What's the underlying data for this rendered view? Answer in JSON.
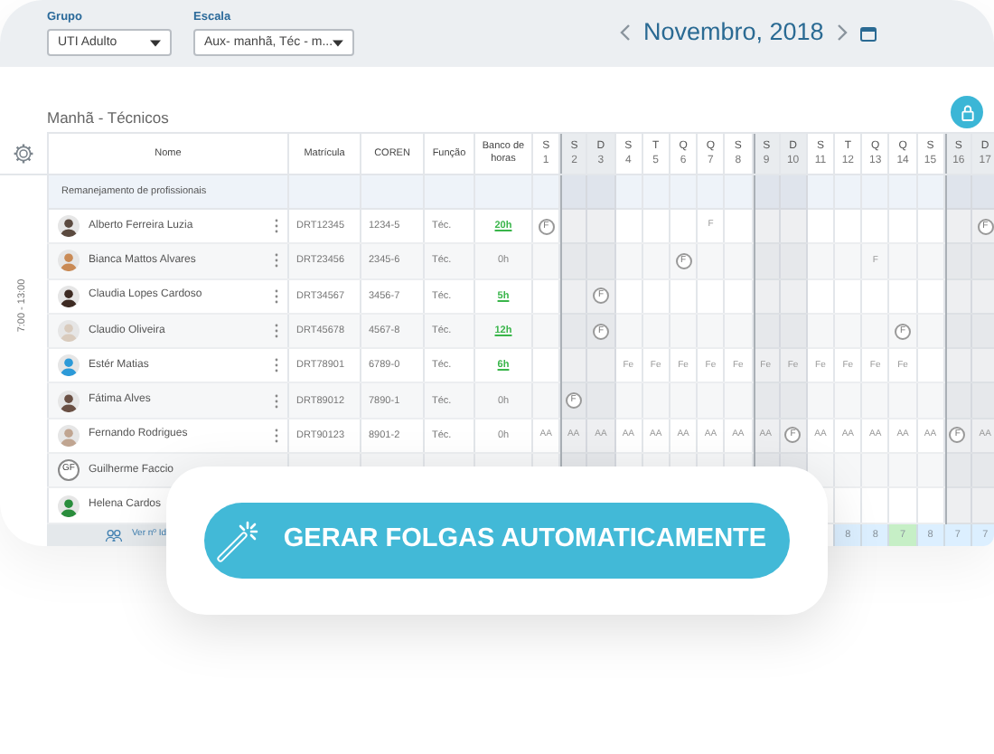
{
  "filters": [
    {
      "label": "Grupo",
      "value": "UTI Adulto"
    },
    {
      "label": "Escala",
      "value": "Aux- manhã, Téc - m..."
    }
  ],
  "month": "Novembro, 2018",
  "section_title": "Manhã - Técnicos",
  "shift": "7:00 - 13:00",
  "columns": [
    "Nome",
    "Matrícula",
    "COREN",
    "Função",
    "Banco de horas"
  ],
  "days": [
    {
      "weekday": "S",
      "number": "1",
      "weekend": false
    },
    {
      "weekday": "S",
      "number": "2",
      "weekend": true
    },
    {
      "weekday": "D",
      "number": "3",
      "weekend": true
    },
    {
      "weekday": "S",
      "number": "4",
      "weekend": false
    },
    {
      "weekday": "T",
      "number": "5",
      "weekend": false
    },
    {
      "weekday": "Q",
      "number": "6",
      "weekend": false
    },
    {
      "weekday": "Q",
      "number": "7",
      "weekend": false
    },
    {
      "weekday": "S",
      "number": "8",
      "weekend": false
    },
    {
      "weekday": "S",
      "number": "9",
      "weekend": true
    },
    {
      "weekday": "D",
      "number": "10",
      "weekend": true
    },
    {
      "weekday": "S",
      "number": "11",
      "weekend": false
    },
    {
      "weekday": "T",
      "number": "12",
      "weekend": false
    },
    {
      "weekday": "Q",
      "number": "13",
      "weekend": false
    },
    {
      "weekday": "Q",
      "number": "14",
      "weekend": false
    },
    {
      "weekday": "S",
      "number": "15",
      "weekend": false
    },
    {
      "weekday": "S",
      "number": "16",
      "weekend": true
    },
    {
      "weekday": "D",
      "number": "17",
      "weekend": true
    }
  ],
  "group_row": "Remanejamento de profissionais",
  "rows": [
    {
      "avatar": {
        "kind": "photo"
      },
      "name": "Alberto Ferreira Luzia",
      "more_button": true,
      "matricula": "DRT12345",
      "coren": "1234-5",
      "funcao": "Téc.",
      "banco": {
        "text": "20h",
        "highlighted": true
      },
      "days": [
        {
          "kind": "badge",
          "text": "F"
        },
        {
          "kind": "empty"
        },
        {
          "kind": "empty"
        },
        {
          "kind": "empty"
        },
        {
          "kind": "empty"
        },
        {
          "kind": "empty"
        },
        {
          "kind": "mark",
          "text": "F"
        },
        {
          "kind": "empty"
        },
        {
          "kind": "empty"
        },
        {
          "kind": "empty"
        },
        {
          "kind": "empty"
        },
        {
          "kind": "empty"
        },
        {
          "kind": "empty"
        },
        {
          "kind": "empty"
        },
        {
          "kind": "empty"
        },
        {
          "kind": "empty"
        },
        {
          "kind": "badge",
          "text": "F"
        }
      ]
    },
    {
      "avatar": {
        "kind": "photo"
      },
      "name": "Bianca Mattos Alvares",
      "more_button": true,
      "matricula": "DRT23456",
      "coren": "2345-6",
      "funcao": "Téc.",
      "banco": {
        "text": "0h",
        "highlighted": false
      },
      "days": [
        {
          "kind": "empty"
        },
        {
          "kind": "empty"
        },
        {
          "kind": "empty"
        },
        {
          "kind": "empty"
        },
        {
          "kind": "empty"
        },
        {
          "kind": "badge",
          "text": "F"
        },
        {
          "kind": "empty"
        },
        {
          "kind": "empty"
        },
        {
          "kind": "empty"
        },
        {
          "kind": "empty"
        },
        {
          "kind": "empty"
        },
        {
          "kind": "empty"
        },
        {
          "kind": "mark",
          "text": "F"
        },
        {
          "kind": "empty"
        },
        {
          "kind": "empty"
        },
        {
          "kind": "empty"
        },
        {
          "kind": "empty"
        }
      ]
    },
    {
      "avatar": {
        "kind": "photo"
      },
      "name": "Claudia Lopes Cardoso",
      "more_button": true,
      "matricula": "DRT34567",
      "coren": "3456-7",
      "funcao": "Téc.",
      "banco": {
        "text": "5h",
        "highlighted": true
      },
      "days": [
        {
          "kind": "empty"
        },
        {
          "kind": "empty"
        },
        {
          "kind": "badge",
          "text": "F"
        },
        {
          "kind": "empty"
        },
        {
          "kind": "empty"
        },
        {
          "kind": "empty"
        },
        {
          "kind": "empty"
        },
        {
          "kind": "empty"
        },
        {
          "kind": "empty"
        },
        {
          "kind": "empty"
        },
        {
          "kind": "empty"
        },
        {
          "kind": "empty"
        },
        {
          "kind": "empty"
        },
        {
          "kind": "empty"
        },
        {
          "kind": "empty"
        },
        {
          "kind": "empty"
        },
        {
          "kind": "empty"
        }
      ]
    },
    {
      "avatar": {
        "kind": "photo"
      },
      "name": "Claudio Oliveira",
      "more_button": true,
      "matricula": "DRT45678",
      "coren": "4567-8",
      "funcao": "Téc.",
      "banco": {
        "text": "12h",
        "highlighted": true
      },
      "days": [
        {
          "kind": "empty"
        },
        {
          "kind": "empty"
        },
        {
          "kind": "badge",
          "text": "F"
        },
        {
          "kind": "empty"
        },
        {
          "kind": "empty"
        },
        {
          "kind": "empty"
        },
        {
          "kind": "empty"
        },
        {
          "kind": "empty"
        },
        {
          "kind": "empty"
        },
        {
          "kind": "empty"
        },
        {
          "kind": "empty"
        },
        {
          "kind": "empty"
        },
        {
          "kind": "empty"
        },
        {
          "kind": "badge",
          "text": "F"
        },
        {
          "kind": "empty"
        },
        {
          "kind": "empty"
        },
        {
          "kind": "empty"
        }
      ]
    },
    {
      "avatar": {
        "kind": "photo"
      },
      "name": "Estér Matias",
      "more_button": true,
      "matricula": "DRT78901",
      "coren": "6789-0",
      "funcao": "Téc.",
      "banco": {
        "text": "6h",
        "highlighted": true
      },
      "days": [
        {
          "kind": "empty"
        },
        {
          "kind": "empty"
        },
        {
          "kind": "empty"
        },
        {
          "kind": "mark",
          "text": "Fe"
        },
        {
          "kind": "mark",
          "text": "Fe"
        },
        {
          "kind": "mark",
          "text": "Fe"
        },
        {
          "kind": "mark",
          "text": "Fe"
        },
        {
          "kind": "mark",
          "text": "Fe"
        },
        {
          "kind": "mark",
          "text": "Fe"
        },
        {
          "kind": "mark",
          "text": "Fe"
        },
        {
          "kind": "mark",
          "text": "Fe"
        },
        {
          "kind": "mark",
          "text": "Fe"
        },
        {
          "kind": "mark",
          "text": "Fe"
        },
        {
          "kind": "mark",
          "text": "Fe"
        },
        {
          "kind": "empty"
        },
        {
          "kind": "empty"
        },
        {
          "kind": "empty"
        }
      ]
    },
    {
      "avatar": {
        "kind": "photo"
      },
      "name": "Fátima Alves",
      "more_button": true,
      "matricula": "DRT89012",
      "coren": "7890-1",
      "funcao": "Téc.",
      "banco": {
        "text": "0h",
        "highlighted": false
      },
      "days": [
        {
          "kind": "empty"
        },
        {
          "kind": "badge",
          "text": "F"
        },
        {
          "kind": "empty"
        },
        {
          "kind": "empty"
        },
        {
          "kind": "empty"
        },
        {
          "kind": "empty"
        },
        {
          "kind": "empty"
        },
        {
          "kind": "empty"
        },
        {
          "kind": "empty"
        },
        {
          "kind": "empty"
        },
        {
          "kind": "empty"
        },
        {
          "kind": "empty"
        },
        {
          "kind": "empty"
        },
        {
          "kind": "empty"
        },
        {
          "kind": "empty"
        },
        {
          "kind": "empty"
        },
        {
          "kind": "empty"
        }
      ]
    },
    {
      "avatar": {
        "kind": "photo"
      },
      "name": "Fernando Rodrigues",
      "more_button": true,
      "matricula": "DRT90123",
      "coren": "8901-2",
      "funcao": "Téc.",
      "banco": {
        "text": "0h",
        "highlighted": false
      },
      "days": [
        {
          "kind": "mark",
          "text": "AA"
        },
        {
          "kind": "mark",
          "text": "AA"
        },
        {
          "kind": "mark",
          "text": "AA"
        },
        {
          "kind": "mark",
          "text": "AA"
        },
        {
          "kind": "mark",
          "text": "AA"
        },
        {
          "kind": "mark",
          "text": "AA"
        },
        {
          "kind": "mark",
          "text": "AA"
        },
        {
          "kind": "mark",
          "text": "AA"
        },
        {
          "kind": "mark",
          "text": "AA"
        },
        {
          "kind": "badge",
          "text": "F"
        },
        {
          "kind": "mark",
          "text": "AA"
        },
        {
          "kind": "mark",
          "text": "AA"
        },
        {
          "kind": "mark",
          "text": "AA"
        },
        {
          "kind": "mark",
          "text": "AA"
        },
        {
          "kind": "mark",
          "text": "AA"
        },
        {
          "kind": "badge",
          "text": "F"
        },
        {
          "kind": "mark",
          "text": "AA"
        }
      ]
    },
    {
      "avatar": {
        "kind": "initials",
        "initials": "GF"
      },
      "name": "Guilherme Faccio",
      "more_button": false,
      "days": [
        {
          "kind": "empty"
        },
        {
          "kind": "empty"
        },
        {
          "kind": "empty"
        },
        {
          "kind": "empty"
        },
        {
          "kind": "empty"
        },
        {
          "kind": "empty"
        },
        {
          "kind": "empty"
        },
        {
          "kind": "empty"
        },
        {
          "kind": "empty"
        },
        {
          "kind": "empty"
        },
        {
          "kind": "empty"
        },
        {
          "kind": "empty"
        },
        {
          "kind": "empty"
        },
        {
          "kind": "empty"
        },
        {
          "kind": "empty"
        },
        {
          "kind": "empty"
        },
        {
          "kind": "empty"
        }
      ]
    },
    {
      "avatar": {
        "kind": "photo"
      },
      "name": "Helena Cardos",
      "more_button": false,
      "days": [
        {
          "kind": "empty"
        },
        {
          "kind": "empty"
        },
        {
          "kind": "empty"
        },
        {
          "kind": "empty"
        },
        {
          "kind": "empty"
        },
        {
          "kind": "empty"
        },
        {
          "kind": "empty"
        },
        {
          "kind": "empty"
        },
        {
          "kind": "empty"
        },
        {
          "kind": "empty"
        },
        {
          "kind": "empty"
        },
        {
          "kind": "empty"
        },
        {
          "kind": "empty"
        },
        {
          "kind": "empty"
        },
        {
          "kind": "empty"
        },
        {
          "kind": "empty"
        },
        {
          "kind": "empty"
        }
      ]
    }
  ],
  "footer": {
    "link": "Ver nº Id",
    "counts": [
      {
        "kind": "empty"
      },
      {
        "kind": "empty"
      },
      {
        "kind": "empty"
      },
      {
        "kind": "empty"
      },
      {
        "kind": "empty"
      },
      {
        "kind": "empty"
      },
      {
        "kind": "empty"
      },
      {
        "kind": "empty"
      },
      {
        "kind": "empty"
      },
      {
        "kind": "empty"
      },
      {
        "kind": "empty"
      },
      {
        "kind": "count",
        "text": "8",
        "highlighted": false
      },
      {
        "kind": "count",
        "text": "8",
        "highlighted": false
      },
      {
        "kind": "count",
        "text": "7",
        "highlighted": true
      },
      {
        "kind": "count",
        "text": "8",
        "highlighted": false
      },
      {
        "kind": "count",
        "text": "7",
        "highlighted": false
      },
      {
        "kind": "count",
        "text": "7",
        "highlighted": false
      }
    ]
  },
  "action_button": "GERAR FOLGAS AUTOMATICAMENTE"
}
